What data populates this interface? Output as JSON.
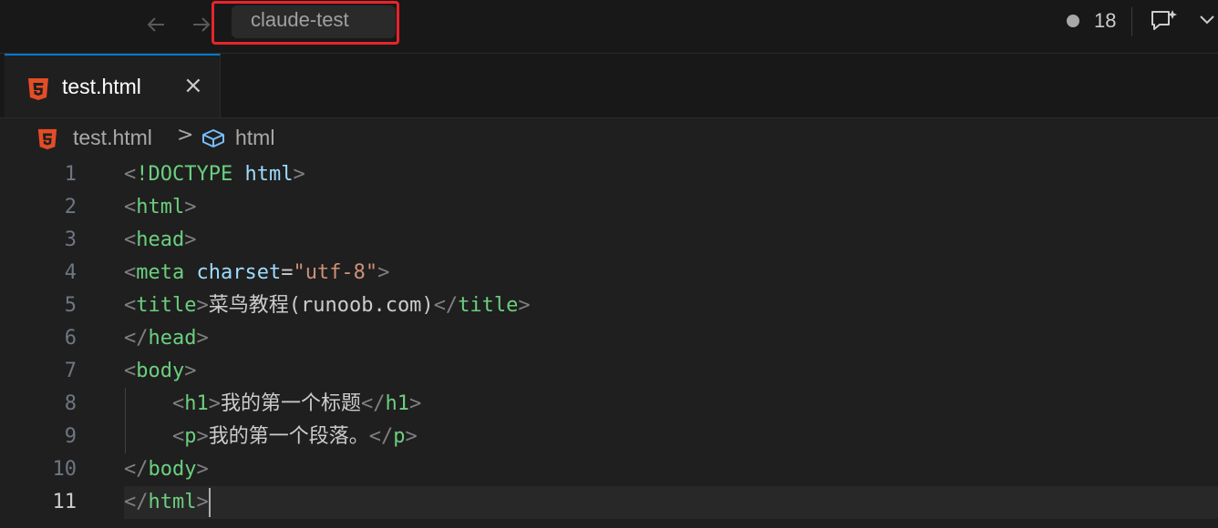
{
  "titlebar": {
    "search_text": "claude-test",
    "count": "18"
  },
  "tab": {
    "label": "test.html",
    "close": "×"
  },
  "breadcrumb": {
    "file": "test.html",
    "separator": ">",
    "symbol": "html"
  },
  "editor": {
    "line_numbers": [
      "1",
      "2",
      "3",
      "4",
      "5",
      "6",
      "7",
      "8",
      "9",
      "10",
      "11"
    ],
    "lines": [
      [
        {
          "t": "<",
          "c": "br"
        },
        {
          "t": "!DOCTYPE",
          "c": "tg"
        },
        {
          "t": " html",
          "c": "attr"
        },
        {
          "t": ">",
          "c": "br"
        }
      ],
      [
        {
          "t": "<",
          "c": "br"
        },
        {
          "t": "html",
          "c": "tg"
        },
        {
          "t": ">",
          "c": "br"
        }
      ],
      [
        {
          "t": "<",
          "c": "br"
        },
        {
          "t": "head",
          "c": "tg"
        },
        {
          "t": ">",
          "c": "br"
        }
      ],
      [
        {
          "t": "<",
          "c": "br"
        },
        {
          "t": "meta",
          "c": "tg"
        },
        {
          "t": " charset",
          "c": "attr"
        },
        {
          "t": "=",
          "c": "pl"
        },
        {
          "t": "\"utf-8\"",
          "c": "str"
        },
        {
          "t": ">",
          "c": "br"
        }
      ],
      [
        {
          "t": "<",
          "c": "br"
        },
        {
          "t": "title",
          "c": "tg"
        },
        {
          "t": ">",
          "c": "br"
        },
        {
          "t": "菜鸟教程(runoob.com)",
          "c": "pl"
        },
        {
          "t": "</",
          "c": "br"
        },
        {
          "t": "title",
          "c": "tg"
        },
        {
          "t": ">",
          "c": "br"
        }
      ],
      [
        {
          "t": "</",
          "c": "br"
        },
        {
          "t": "head",
          "c": "tg"
        },
        {
          "t": ">",
          "c": "br"
        }
      ],
      [
        {
          "t": "<",
          "c": "br"
        },
        {
          "t": "body",
          "c": "tg"
        },
        {
          "t": ">",
          "c": "br"
        }
      ],
      [
        {
          "t": "    <",
          "c": "br"
        },
        {
          "t": "h1",
          "c": "tg"
        },
        {
          "t": ">",
          "c": "br"
        },
        {
          "t": "我的第一个标题",
          "c": "pl"
        },
        {
          "t": "</",
          "c": "br"
        },
        {
          "t": "h1",
          "c": "tg"
        },
        {
          "t": ">",
          "c": "br"
        }
      ],
      [
        {
          "t": "    <",
          "c": "br"
        },
        {
          "t": "p",
          "c": "tg"
        },
        {
          "t": ">",
          "c": "br"
        },
        {
          "t": "我的第一个段落。",
          "c": "pl"
        },
        {
          "t": "</",
          "c": "br"
        },
        {
          "t": "p",
          "c": "tg"
        },
        {
          "t": ">",
          "c": "br"
        }
      ],
      [
        {
          "t": "</",
          "c": "br"
        },
        {
          "t": "body",
          "c": "tg"
        },
        {
          "t": ">",
          "c": "br"
        }
      ],
      [
        {
          "t": "</",
          "c": "br"
        },
        {
          "t": "html",
          "c": "tg"
        },
        {
          "t": ">",
          "c": "br"
        }
      ]
    ],
    "active_line": 11
  },
  "colors": {
    "accent": "#0078d4",
    "highlight": "#e8242c",
    "html5_icon": "#e44d26"
  },
  "icons": [
    "arrow-left-icon",
    "arrow-right-icon",
    "chat-icon",
    "chevron-down-icon",
    "html5-icon",
    "symbol-cube-icon",
    "close-icon"
  ]
}
